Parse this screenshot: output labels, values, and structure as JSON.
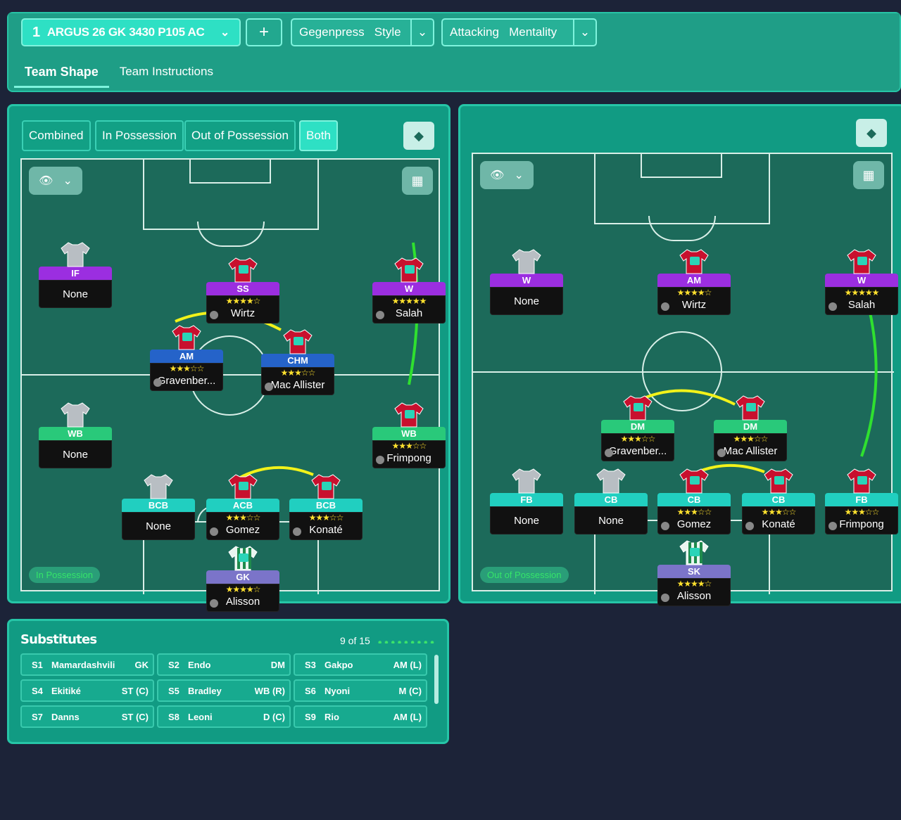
{
  "header": {
    "tactic_number": "1",
    "tactic_name": "ARGUS 26 GK 3430 P105 AC",
    "add_label": "+",
    "style_value": "Gegenpress",
    "style_label": "Style",
    "mentality_value": "Attacking",
    "mentality_label": "Mentality"
  },
  "tabs": [
    "Team Shape",
    "Team Instructions"
  ],
  "view_modes": [
    "Combined",
    "In Possession",
    "Out of Possession",
    "Both"
  ],
  "left_pitch": {
    "mode_label": "In Possession",
    "players": [
      {
        "role": "IF",
        "name": "None",
        "stars": "",
        "color": "purple"
      },
      {
        "role": "SS",
        "name": "Wirtz",
        "stars": "★★★★☆",
        "color": "purple"
      },
      {
        "role": "W",
        "name": "Salah",
        "stars": "★★★★★",
        "color": "purple"
      },
      {
        "role": "AM",
        "name": "Gravenber...",
        "stars": "★★★☆☆",
        "color": "blue"
      },
      {
        "role": "CHM",
        "name": "Mac Allister",
        "stars": "★★★☆☆",
        "color": "blue"
      },
      {
        "role": "WB",
        "name": "None",
        "stars": "",
        "color": "green"
      },
      {
        "role": "WB",
        "name": "Frimpong",
        "stars": "★★★☆☆",
        "color": "green"
      },
      {
        "role": "BCB",
        "name": "None",
        "stars": "",
        "color": "teal"
      },
      {
        "role": "ACB",
        "name": "Gomez",
        "stars": "★★★☆☆",
        "color": "teal"
      },
      {
        "role": "BCB",
        "name": "Konaté",
        "stars": "★★★☆☆",
        "color": "teal"
      },
      {
        "role": "GK",
        "name": "Alisson",
        "stars": "★★★★☆",
        "color": "lav"
      }
    ]
  },
  "right_pitch": {
    "mode_label": "Out of Possession",
    "players": [
      {
        "role": "W",
        "name": "None",
        "stars": "",
        "color": "purple"
      },
      {
        "role": "AM",
        "name": "Wirtz",
        "stars": "★★★★☆",
        "color": "purple"
      },
      {
        "role": "W",
        "name": "Salah",
        "stars": "★★★★★",
        "color": "purple"
      },
      {
        "role": "DM",
        "name": "Gravenber...",
        "stars": "★★★☆☆",
        "color": "green"
      },
      {
        "role": "DM",
        "name": "Mac Allister",
        "stars": "★★★☆☆",
        "color": "green"
      },
      {
        "role": "FB",
        "name": "None",
        "stars": "",
        "color": "teal"
      },
      {
        "role": "CB",
        "name": "None",
        "stars": "",
        "color": "teal"
      },
      {
        "role": "CB",
        "name": "Gomez",
        "stars": "★★★☆☆",
        "color": "teal"
      },
      {
        "role": "CB",
        "name": "Konaté",
        "stars": "★★★☆☆",
        "color": "teal"
      },
      {
        "role": "FB",
        "name": "Frimpong",
        "stars": "★★★☆☆",
        "color": "teal"
      },
      {
        "role": "SK",
        "name": "Alisson",
        "stars": "★★★★☆",
        "color": "lav"
      }
    ]
  },
  "substitutes": {
    "title": "Substitutes",
    "count": "9 of 15",
    "items": [
      {
        "slot": "S1",
        "name": "Mamardashvili",
        "pos": "GK"
      },
      {
        "slot": "S2",
        "name": "Endo",
        "pos": "DM"
      },
      {
        "slot": "S3",
        "name": "Gakpo",
        "pos": "AM (L)"
      },
      {
        "slot": "S4",
        "name": "Ekitiké",
        "pos": "ST (C)"
      },
      {
        "slot": "S5",
        "name": "Bradley",
        "pos": "WB (R)"
      },
      {
        "slot": "S6",
        "name": "Nyoni",
        "pos": "M (C)"
      },
      {
        "slot": "S7",
        "name": "Danns",
        "pos": "ST (C)"
      },
      {
        "slot": "S8",
        "name": "Leoni",
        "pos": "D (C)"
      },
      {
        "slot": "S9",
        "name": "Rio",
        "pos": "AM (L)"
      }
    ]
  },
  "colors": {
    "purple": "#9b2ee0",
    "blue": "#2563c9",
    "green": "#29c97a",
    "teal": "#21cfc0",
    "lav": "#7b74c9",
    "link_yellow": "#f2f21a",
    "link_green": "#2fe02f"
  }
}
